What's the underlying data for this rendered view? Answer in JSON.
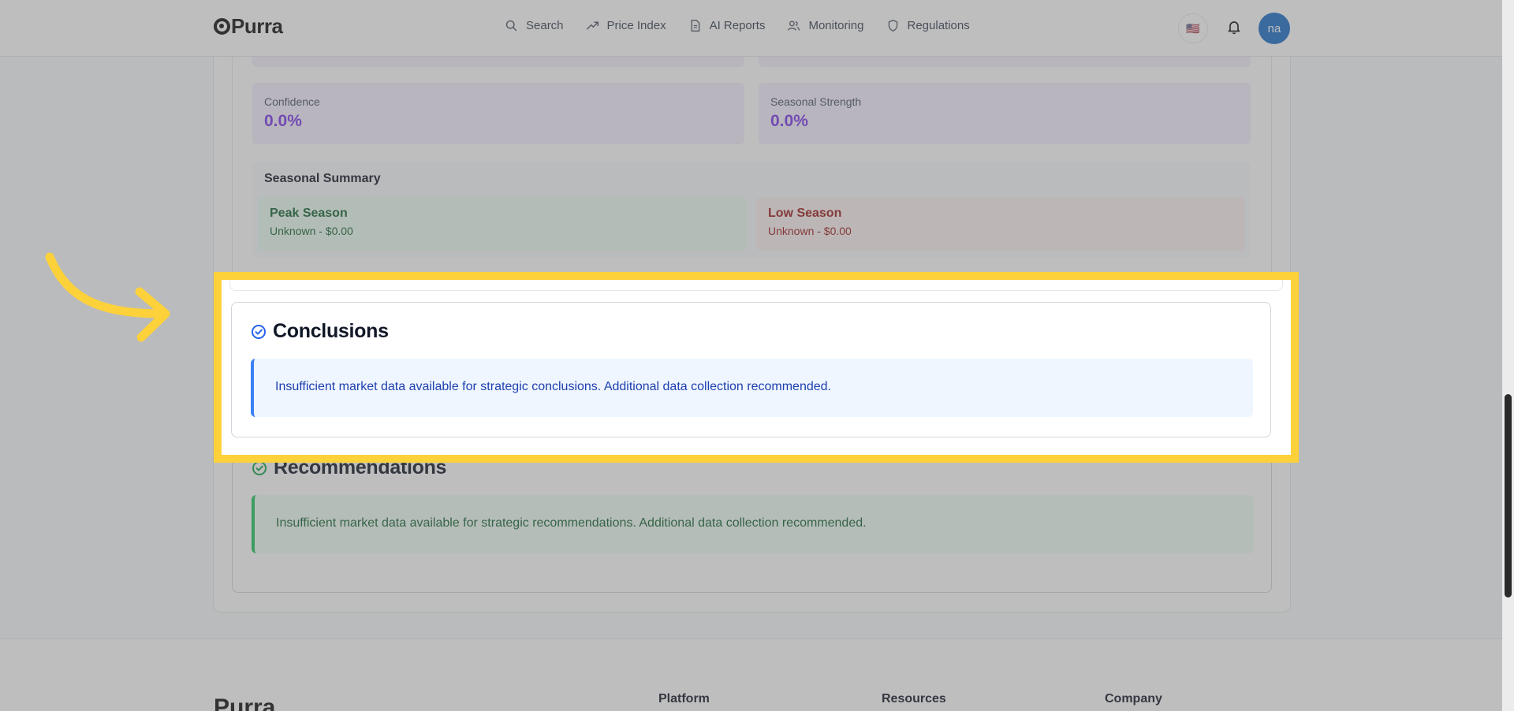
{
  "navbar": {
    "logo_text": "Purra",
    "items": [
      {
        "label": "Search",
        "icon": "search-icon"
      },
      {
        "label": "Price Index",
        "icon": "trend-icon"
      },
      {
        "label": "AI Reports",
        "icon": "document-icon"
      },
      {
        "label": "Monitoring",
        "icon": "users-icon"
      },
      {
        "label": "Regulations",
        "icon": "shield-icon"
      }
    ],
    "flag": "🇺🇸",
    "avatar_initials": "na"
  },
  "metrics": [
    {
      "label": "Confidence",
      "value": "0.0%"
    },
    {
      "label": "Seasonal Strength",
      "value": "0.0%"
    }
  ],
  "seasonal_summary": {
    "title": "Seasonal Summary",
    "peak": {
      "name": "Peak Season",
      "value": "Unknown - $0.00"
    },
    "low": {
      "name": "Low Season",
      "value": "Unknown - $0.00"
    }
  },
  "conclusions": {
    "title": "Conclusions",
    "text": "Insufficient market data available for strategic conclusions. Additional data collection recommended."
  },
  "recommendations": {
    "title": "Recommendations",
    "text": "Insufficient market data available for strategic recommendations. Additional data collection recommended."
  },
  "footer": {
    "logo_text": "Purra",
    "columns": [
      "Platform",
      "Resources",
      "Company"
    ]
  },
  "colors": {
    "highlight": "#fdd13a",
    "accent_purple": "#7c3aed",
    "info_blue": "#1e40af",
    "success_green": "#166534"
  }
}
